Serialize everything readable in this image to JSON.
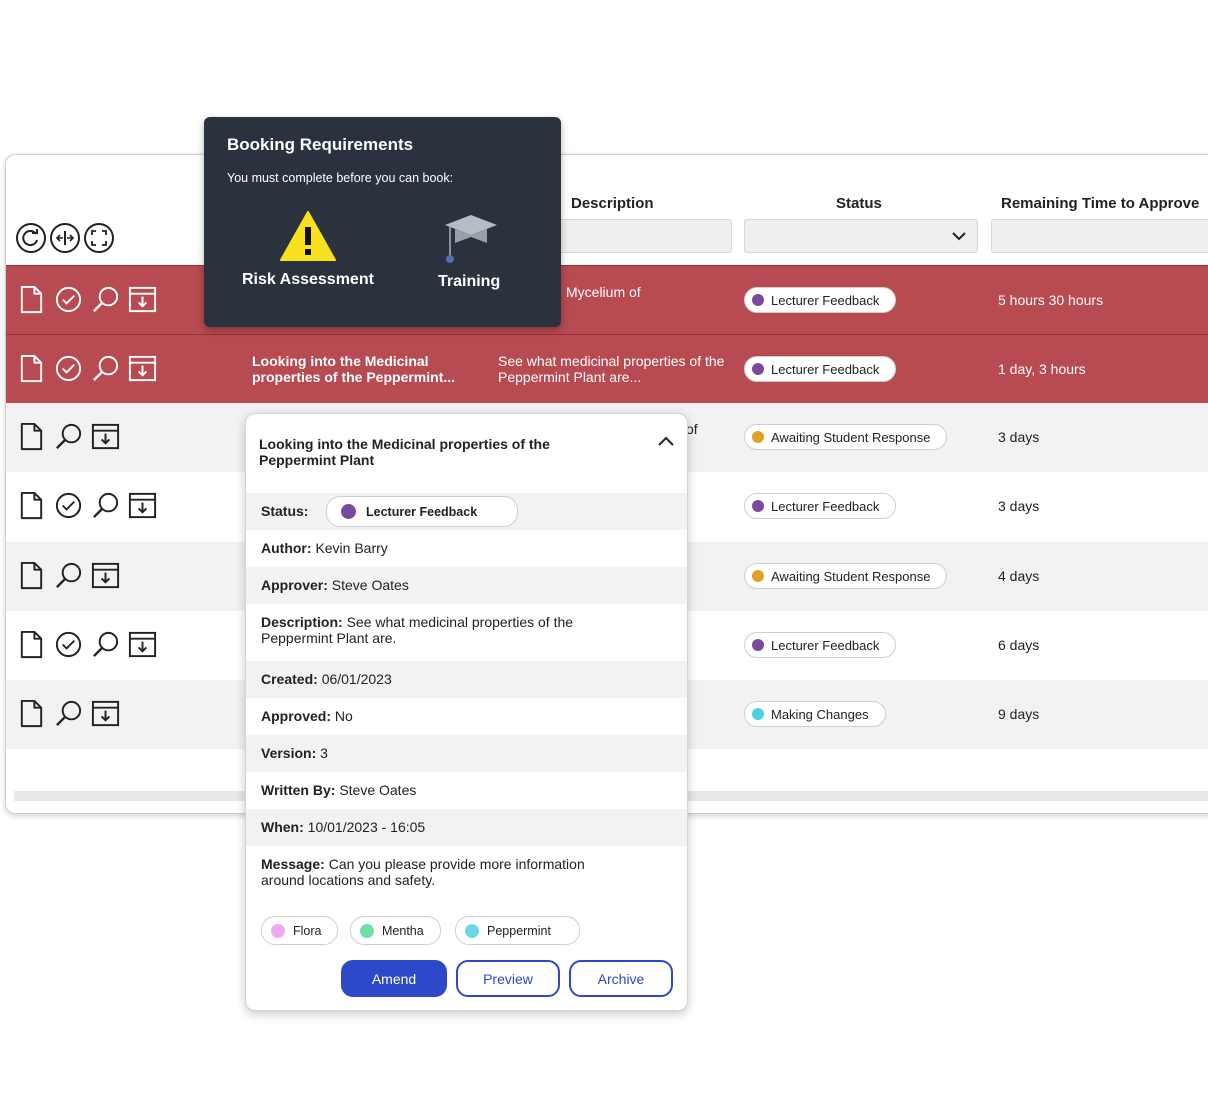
{
  "table": {
    "headers": {
      "description": "Description",
      "status": "Status",
      "remaining": "Remaining Time to Approve"
    },
    "rows": [
      {
        "desc": "Mycelium of",
        "status": "Lecturer Feedback",
        "status_color": "#7b4a9e",
        "time": "5 hours 30 hours"
      },
      {
        "title": "Looking into the Medicinal properties of the Peppermint...",
        "desc": "See what medicinal properties of the Peppermint Plant are...",
        "status": "Lecturer Feedback",
        "status_color": "#7b4a9e",
        "time": "1 day, 3 hours"
      },
      {
        "status": "Awaiting Student Response",
        "status_color": "#e0a21e",
        "time": "3 days",
        "desc_tail": "of"
      },
      {
        "status": "Lecturer Feedback",
        "status_color": "#7b4a9e",
        "time": "3 days"
      },
      {
        "status": "Awaiting Student Response",
        "status_color": "#e0a21e",
        "time": "4 days"
      },
      {
        "status": "Lecturer Feedback",
        "status_color": "#7b4a9e",
        "time": "6 days"
      },
      {
        "status": "Making Changes",
        "status_color": "#4fd0e0",
        "time": "9 days"
      }
    ]
  },
  "booking": {
    "title": "Booking Requirements",
    "subtitle": "You must complete before you can book:",
    "items": [
      {
        "label": "Risk Assessment",
        "icon": "warning-icon"
      },
      {
        "label": "Training",
        "icon": "graduation-cap-icon"
      }
    ]
  },
  "detail": {
    "title": "Looking into the Medicinal properties of the Peppermint Plant",
    "status_label": "Status:",
    "status_value": "Lecturer Feedback",
    "status_color": "#7b4a9e",
    "author_label": "Author:",
    "author": "Kevin Barry",
    "approver_label": "Approver:",
    "approver": "Steve Oates",
    "description_label": "Description:",
    "description": "See what medicinal properties of the Peppermint Plant are.",
    "created_label": "Created:",
    "created": "06/01/2023",
    "approved_label": "Approved:",
    "approved": "No",
    "version_label": "Version:",
    "version": "3",
    "written_by_label": "Written By:",
    "written_by": "Steve Oates",
    "when_label": "When:",
    "when": "10/01/2023 - 16:05",
    "message_label": "Message:",
    "message": "Can you please provide more information around locations and safety.",
    "tags": [
      {
        "label": "Flora",
        "color": "#f0a8ee"
      },
      {
        "label": "Mentha",
        "color": "#6fe0a8"
      },
      {
        "label": "Peppermint",
        "color": "#6fd8e6"
      }
    ],
    "buttons": {
      "amend": "Amend",
      "preview": "Preview",
      "archive": "Archive"
    }
  },
  "colors": {
    "row_highlight": "#b84a51",
    "accent": "#2d48c8",
    "tooltip_bg": "#2a323e"
  }
}
